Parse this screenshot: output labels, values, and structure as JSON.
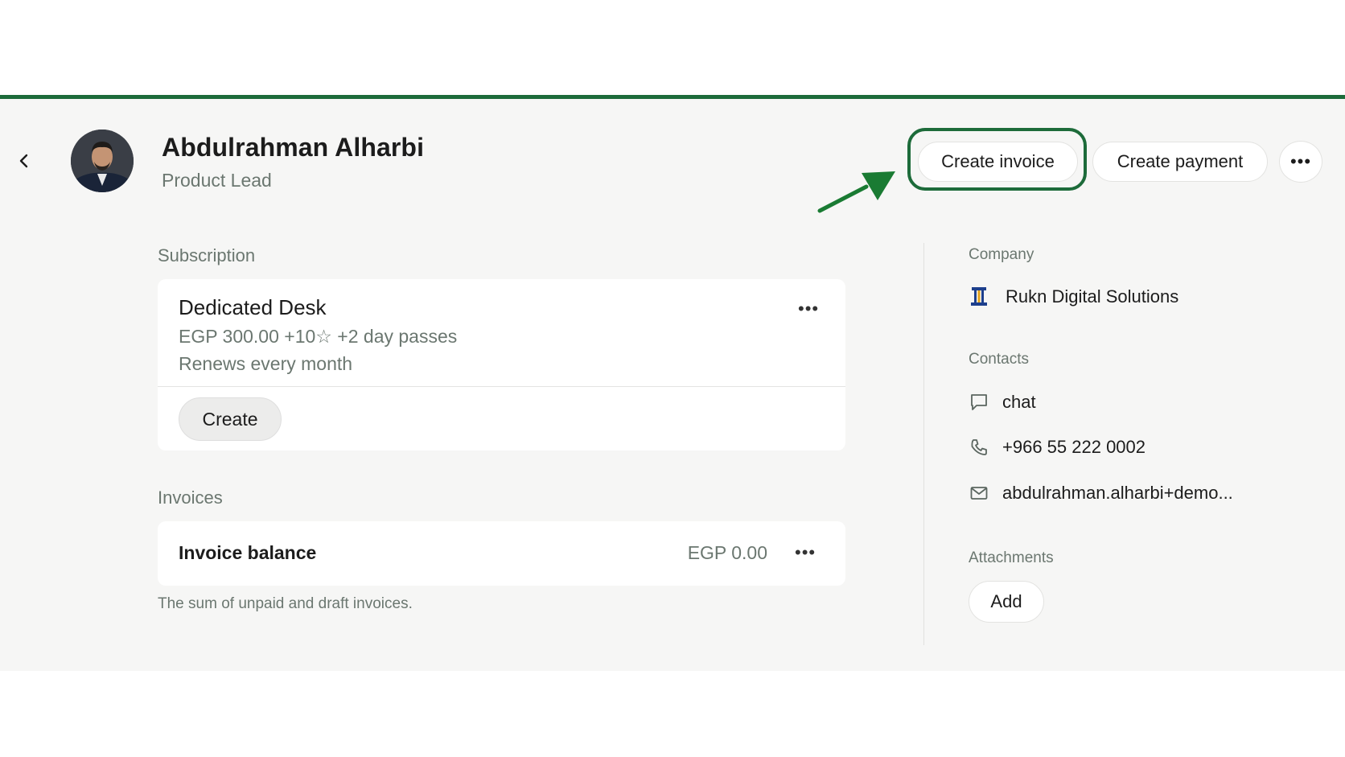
{
  "header": {
    "name": "Abdulrahman Alharbi",
    "role": "Product Lead",
    "create_invoice_label": "Create invoice",
    "create_payment_label": "Create payment",
    "more_label": "•••"
  },
  "subscription": {
    "section_label": "Subscription",
    "plan_name": "Dedicated Desk",
    "price_line": "EGP 300.00 +10☆ +2 day passes",
    "renew_line": "Renews every month",
    "create_label": "Create",
    "more_label": "•••"
  },
  "invoices": {
    "section_label": "Invoices",
    "balance_label": "Invoice balance",
    "balance_amount": "EGP 0.00",
    "more_label": "•••",
    "note": "The sum of unpaid and draft invoices."
  },
  "sidebar": {
    "company_label": "Company",
    "company_name": "Rukn Digital Solutions",
    "contacts_label": "Contacts",
    "contacts": [
      {
        "icon": "chat-bubble-icon",
        "value": "chat"
      },
      {
        "icon": "phone-icon",
        "value": "+966 55 222 0002"
      },
      {
        "icon": "mail-icon",
        "value": "abdulrahman.alharbi+demo..."
      }
    ],
    "attachments_label": "Attachments",
    "add_label": "Add"
  },
  "colors": {
    "accent_green": "#1d6b3a",
    "background": "#f6f6f5",
    "muted_text": "#6b7770"
  }
}
